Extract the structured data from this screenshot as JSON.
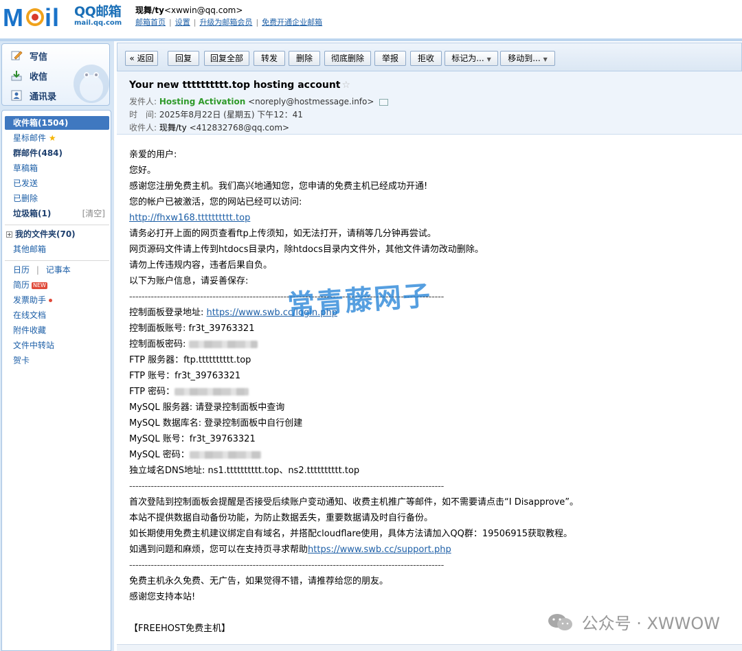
{
  "header": {
    "logo_cn": "QQ邮箱",
    "logo_url": "mail.qq.com",
    "user_name": "现舞/ty",
    "user_email": "<xwwin@qq.com>",
    "links": [
      "邮箱首页",
      "设置",
      "升级为邮箱会员",
      "免费开通企业邮箱"
    ]
  },
  "sidebar": {
    "compose": "写信",
    "receive": "收信",
    "contacts": "通讯录",
    "folders": {
      "inbox": "收件箱(1504)",
      "starred": "星标邮件",
      "group": "群邮件(484)",
      "drafts": "草稿箱",
      "sent": "已发送",
      "deleted": "已删除",
      "junk": "垃圾箱(1)",
      "junk_clear": "[清空]",
      "my_folders": "我的文件夹(70)",
      "other": "其他邮箱"
    },
    "tools": {
      "calendar": "日历",
      "notes": "记事本",
      "resume": "简历",
      "new_badge": "NEW",
      "invoice": "发票助手",
      "docs": "在线文档",
      "attach": "附件收藏",
      "transfer": "文件中转站",
      "cards": "贺卡"
    }
  },
  "toolbar": {
    "back": "« 返回",
    "reply": "回复",
    "reply_all": "回复全部",
    "forward": "转发",
    "delete": "删除",
    "delete_perm": "彻底删除",
    "report": "举报",
    "reject": "拒收",
    "mark_as": "标记为...",
    "move_to": "移动到..."
  },
  "mail": {
    "subject": "Your new tttttttttt.top hosting account",
    "from_label": "发件人:",
    "from_name": "Hosting Activation",
    "from_email": "<noreply@hostmessage.info>",
    "time_label": "时　间:",
    "time_value": "2025年8月22日 (星期五) 下午12：41",
    "to_label": "收件人:",
    "to_name": "现舞/ty",
    "to_email": "<412832768@qq.com>"
  },
  "body": {
    "l1": "亲爱的用户:",
    "l2": "您好。",
    "l3": "感谢您注册免费主机。我们高兴地通知您，您申请的免费主机已经成功开通!",
    "l4": "您的帐户已被激活，您的网站已经可以访问:",
    "site_link": "http://fhxw168.tttttttttt.top",
    "l5": "请务必打开上面的网页查看ftp上传须知，如无法打开，请稍等几分钟再尝试。",
    "l6": "网页源码文件请上传到htdocs目录内，除htdocs目录内文件外，其他文件请勿改动删除。",
    "l7": "请勿上传违规内容，违者后果自负。",
    "l8": "以下为账户信息，请妥善保存:",
    "dashes": "------------------------------------------------------------------------------------------------------",
    "cp_url_label": "控制面板登录地址: ",
    "cp_url": "https://www.swb.cc/login.php",
    "cp_user": "控制面板账号: fr3t_39763321",
    "cp_pass_label": "控制面板密码: ",
    "ftp_server": "FTP 服务器：ftp.tttttttttt.top",
    "ftp_user": "FTP 账号：fr3t_39763321",
    "ftp_pass_label": "FTP 密码：",
    "mysql_server": "MySQL 服务器: 请登录控制面板中查询",
    "mysql_db": "MySQL 数据库名: 登录控制面板中自行创建",
    "mysql_user": "MySQL 账号：fr3t_39763321",
    "mysql_pass_label": "MySQL 密码：",
    "dns": "独立域名DNS地址:  ns1.tttttttttt.top、ns2.tttttttttt.top",
    "n1": "首次登陆到控制面板会提醒是否接受后续账户变动通知、收费主机推广等邮件，如不需要请点击“I Disapprove”。",
    "n2": "本站不提供数据自动备份功能，为防止数据丢失，重要数据请及时自行备份。",
    "n3": "如长期使用免费主机建议绑定自有域名，并搭配cloudflare使用，具体方法请加入QQ群：19506915获取教程。",
    "n4": "如遇到问题和麻烦，您可以在支持页寻求帮助",
    "support_link": "https://www.swb.cc/support.php",
    "f1": "免费主机永久免费、无广告，如果觉得不错，请推荐给您的朋友。",
    "f2": "感谢您支持本站!",
    "sign": "【FREEHOST免费主机】"
  },
  "watermark": "常青藤网子",
  "wechat_mark": "公众号 · XWWOW"
}
